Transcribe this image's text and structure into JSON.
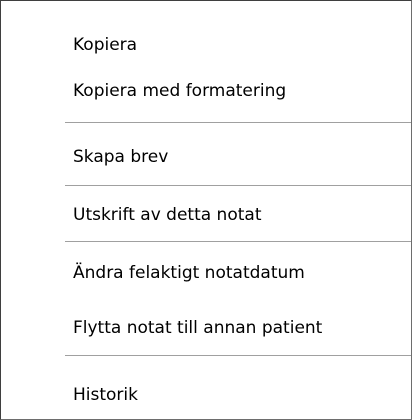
{
  "context_menu": {
    "items": [
      {
        "label": "Kopiera"
      },
      {
        "label": "Kopiera med formatering"
      },
      {
        "label": "Skapa brev"
      },
      {
        "label": "Utskrift av detta notat"
      },
      {
        "label": "Ändra felaktigt notatdatum"
      },
      {
        "label": "Flytta notat till annan patient"
      },
      {
        "label": "Historik"
      }
    ]
  }
}
